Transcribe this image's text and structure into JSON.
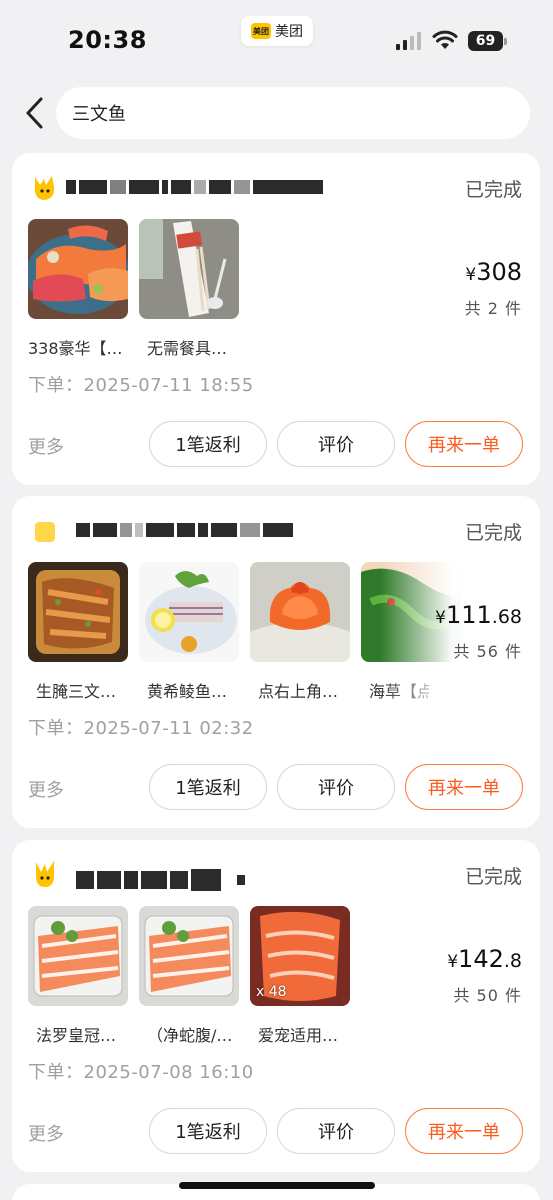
{
  "status_bar": {
    "time": "20:38",
    "app_logo_text": "美团",
    "app_name": "美团",
    "battery": "69"
  },
  "search": {
    "query": "三文鱼",
    "back_icon": "chevron-left-icon"
  },
  "colors": {
    "accent": "#ff5a1e",
    "background": "#f1f0f3",
    "card": "#ffffff"
  },
  "orders": [
    {
      "status": "已完成",
      "items": [
        {
          "label": "338豪华【…",
          "image": "sashimi-platter",
          "qty": ""
        },
        {
          "label": "无需餐具…",
          "image": "chopsticks-package",
          "qty": ""
        }
      ],
      "price_currency": "¥",
      "price_int": "308",
      "price_dec": "",
      "count": "共 2 件",
      "time": "下单：2025-07-11 18:55",
      "more": "更多",
      "btn_rebate": "1笔返利",
      "btn_review": "评价",
      "btn_reorder": "再来一单"
    },
    {
      "status": "已完成",
      "items": [
        {
          "label": "生腌三文…",
          "image": "marinated-salmon-tray",
          "qty": ""
        },
        {
          "label": "黄希鲮鱼…",
          "image": "yellowtail-sashimi",
          "qty": ""
        },
        {
          "label": "点右上角…",
          "image": "salmon-rose",
          "qty": ""
        },
        {
          "label": "海草【点…",
          "image": "seaweed-salad",
          "qty": ""
        }
      ],
      "price_currency": "¥",
      "price_int": "111",
      "price_dec": ".68",
      "count": "共 56 件",
      "time": "下单：2025-07-11 02:32",
      "more": "更多",
      "btn_rebate": "1笔返利",
      "btn_review": "评价",
      "btn_reorder": "再来一单"
    },
    {
      "status": "已完成",
      "items": [
        {
          "label": "法罗皇冠…",
          "image": "faroe-salmon-box",
          "qty": ""
        },
        {
          "label": "（净蛇腹/…",
          "image": "faroe-salmon-box",
          "qty": ""
        },
        {
          "label": "爱宠适用…",
          "image": "salmon-slices",
          "qty": "x 48"
        }
      ],
      "price_currency": "¥",
      "price_int": "142",
      "price_dec": ".8",
      "count": "共 50 件",
      "time": "下单：2025-07-08 16:10",
      "more": "更多",
      "btn_rebate": "1笔返利",
      "btn_review": "评价",
      "btn_reorder": "再来一单"
    }
  ]
}
